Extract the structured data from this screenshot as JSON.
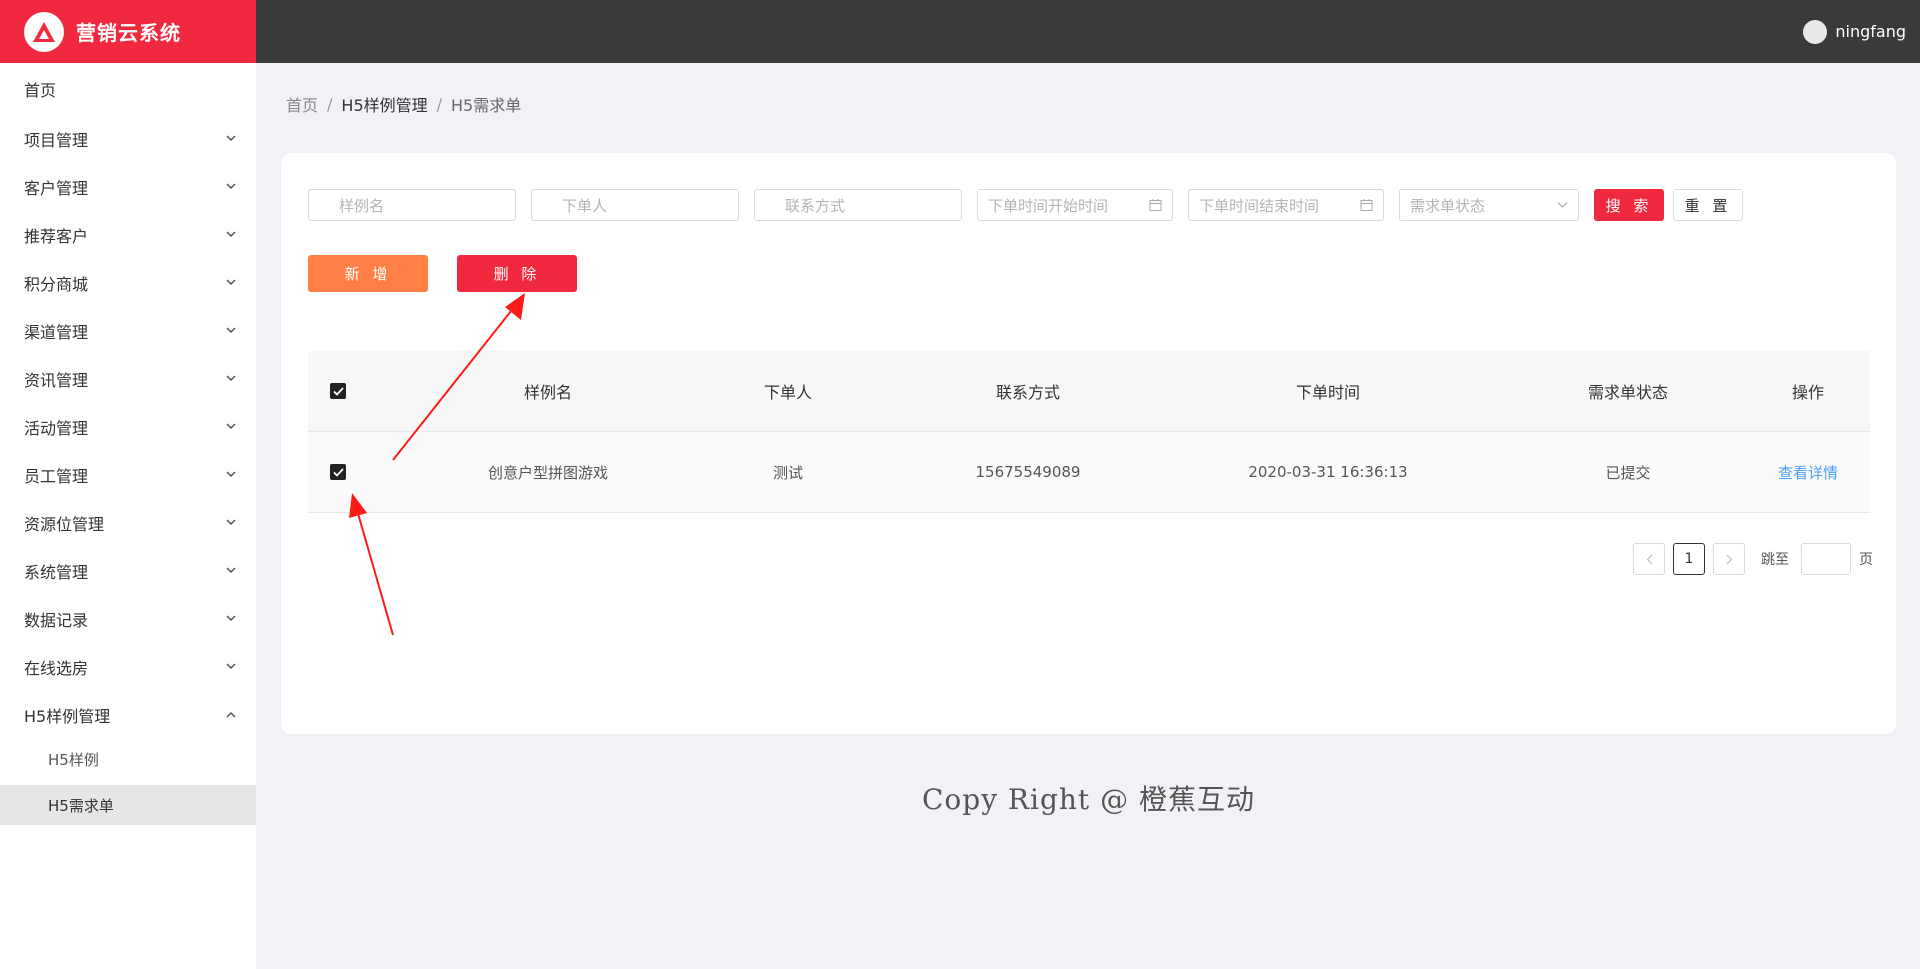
{
  "app": {
    "title": "营销云系统",
    "brand_color": "#f0293e",
    "logo_icon": "logo-triangle-icon"
  },
  "header": {
    "username": "ningfang"
  },
  "sidebar": {
    "items": [
      {
        "label": "首页"
      },
      {
        "label": "项目管理"
      },
      {
        "label": "客户管理"
      },
      {
        "label": "推荐客户"
      },
      {
        "label": "积分商城"
      },
      {
        "label": "渠道管理"
      },
      {
        "label": "资讯管理"
      },
      {
        "label": "活动管理"
      },
      {
        "label": "员工管理"
      },
      {
        "label": "资源位管理"
      },
      {
        "label": "系统管理"
      },
      {
        "label": "数据记录"
      },
      {
        "label": "在线选房"
      },
      {
        "label": "H5样例管理"
      }
    ],
    "subitems": [
      {
        "label": "H5样例"
      },
      {
        "label": "H5需求单"
      }
    ]
  },
  "breadcrumb": {
    "home": "首页",
    "parent": "H5样例管理",
    "current": "H5需求单"
  },
  "filters": {
    "sample_name": "样例名",
    "orderer": "下单人",
    "contact": "联系方式",
    "start_time": "下单时间开始时间",
    "end_time": "下单时间结束时间",
    "status": "需求单状态"
  },
  "buttons": {
    "search": "搜 索",
    "reset": "重 置",
    "add": "新 增",
    "delete": "删 除"
  },
  "table": {
    "headers": [
      "样例名",
      "下单人",
      "联系方式",
      "下单时间",
      "需求单状态",
      "操作"
    ],
    "rows": [
      {
        "sample_name": "创意户型拼图游戏",
        "orderer": "测试",
        "contact": "15675549089",
        "time": "2020-03-31 16:36:13",
        "status": "已提交",
        "action": "查看详情"
      }
    ]
  },
  "pagination": {
    "page": "1",
    "goto_label": "跳至",
    "page_unit": "页"
  },
  "footer": {
    "text": "Copy Right @ 橙蕉互动"
  },
  "colors": {
    "accent_orange": "#ff7f46",
    "link": "#4b9ff5",
    "annotation_arrow": "#ff1a1a"
  }
}
